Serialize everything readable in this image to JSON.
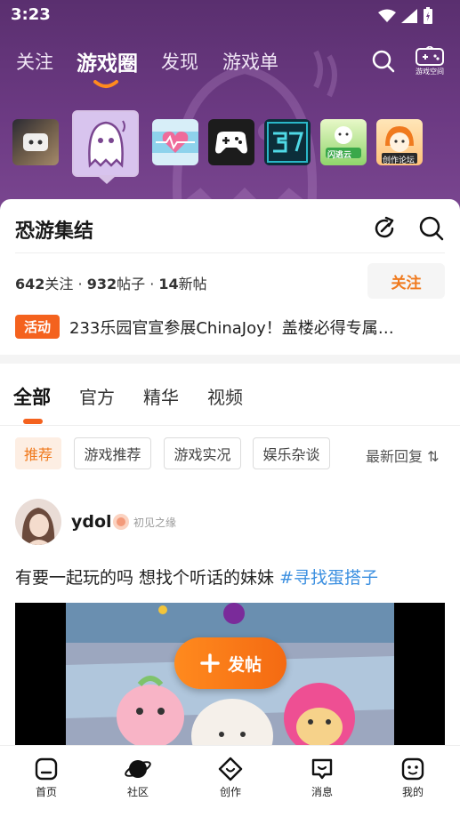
{
  "status": {
    "time": "3:23"
  },
  "top_nav": {
    "tabs": [
      "关注",
      "游戏圈",
      "发现",
      "游戏单"
    ],
    "active_index": 1,
    "game_space_label": "游戏空间"
  },
  "games": [
    {
      "name": "game-1"
    },
    {
      "name": "恐游集结"
    },
    {
      "name": "game-3"
    },
    {
      "name": "game-4"
    },
    {
      "name": "game-5"
    },
    {
      "name": "闪逃云"
    },
    {
      "name": "创作论坛"
    }
  ],
  "circle": {
    "title": "恐游集结",
    "followers": "642",
    "followers_label": "关注",
    "posts": "932",
    "posts_label": "帖子",
    "new_posts": "14",
    "new_posts_label": "新帖",
    "follow_button": "关注",
    "event_tag": "活动",
    "event_text": "233乐园官宣参展ChinaJoy！盖楼必得专属…"
  },
  "content_tabs": [
    "全部",
    "官方",
    "精华",
    "视频"
  ],
  "filters": {
    "chips": [
      "推荐",
      "游戏推荐",
      "游戏实况",
      "娱乐杂谈"
    ],
    "sort_label": "最新回复 ⇅"
  },
  "post": {
    "username": "ydol",
    "badge": "初见之缘",
    "text": "有要一起玩的吗 想找个听话的妹妹",
    "hashtag": "#寻找蛋搭子"
  },
  "fab": {
    "label": "发帖"
  },
  "bottom_nav": [
    {
      "label": "首页",
      "icon": "home-icon"
    },
    {
      "label": "社区",
      "icon": "planet-icon"
    },
    {
      "label": "创作",
      "icon": "create-icon"
    },
    {
      "label": "消息",
      "icon": "message-icon"
    },
    {
      "label": "我的",
      "icon": "profile-icon"
    }
  ],
  "colors": {
    "accent": "#f4621e",
    "hero": "#6c3a83",
    "hashtag": "#3b8fe0"
  }
}
